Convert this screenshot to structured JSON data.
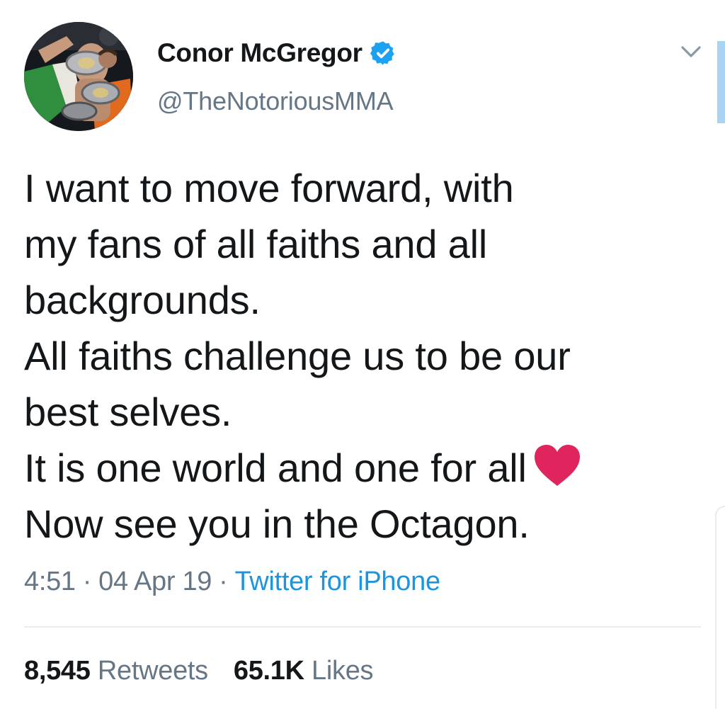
{
  "tweet": {
    "author": {
      "display_name": "Conor McGregor",
      "handle": "@TheNotoriousMMA",
      "verified": true
    },
    "text_lines": [
      "I want to move forward, with",
      "my fans of all faiths and all",
      "backgrounds.",
      "All faiths challenge us to be our",
      "best selves.",
      "It is one world and one for all",
      "Now see you in the Octagon."
    ],
    "emoji": "red-heart",
    "time": "4:51",
    "date": "04 Apr 19",
    "separator": "·",
    "source": "Twitter for iPhone",
    "retweets_count": "8,545",
    "retweets_label": "Retweets",
    "likes_count": "65.1K",
    "likes_label": "Likes"
  },
  "icons": {
    "verified": "verified-badge-icon",
    "more": "chevron-down-icon",
    "heart": "red-heart-icon"
  },
  "colors": {
    "text": "#14171a",
    "secondary_text": "#657786",
    "link": "#1b95e0",
    "verified": "#1da1f2",
    "heart": "#e0245e",
    "divider": "#e6ecf0"
  }
}
